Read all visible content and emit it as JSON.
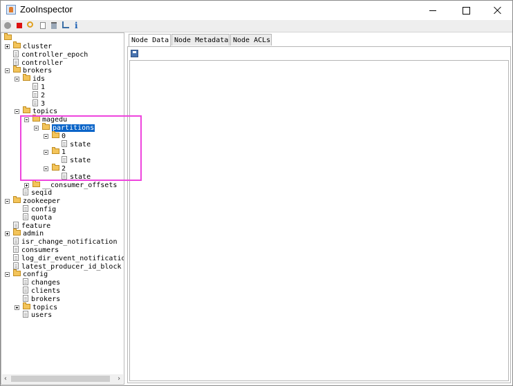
{
  "window": {
    "title": "ZooInspector",
    "controls": {
      "minimize": "minimize-icon",
      "maximize": "maximize-icon",
      "close": "close-icon"
    }
  },
  "toolbar": {
    "buttons": [
      "connect-icon",
      "disconnect-icon",
      "refresh-icon",
      "add-node-icon",
      "delete-node-icon",
      "add-watch-icon",
      "info-icon"
    ],
    "info_glyph": "i"
  },
  "tree": {
    "nodes": [
      {
        "label": "cluster",
        "type": "folder",
        "depth": 1,
        "expander": "plus"
      },
      {
        "label": "controller_epoch",
        "type": "file",
        "depth": 1
      },
      {
        "label": "controller",
        "type": "file",
        "depth": 1
      },
      {
        "label": "brokers",
        "type": "folder",
        "depth": 1,
        "expander": "minus"
      },
      {
        "label": "ids",
        "type": "folder",
        "depth": 2,
        "expander": "minus"
      },
      {
        "label": "1",
        "type": "file",
        "depth": 3
      },
      {
        "label": "2",
        "type": "file",
        "depth": 3
      },
      {
        "label": "3",
        "type": "file",
        "depth": 3
      },
      {
        "label": "topics",
        "type": "folder",
        "depth": 2,
        "expander": "minus"
      },
      {
        "label": "magedu",
        "type": "folder",
        "depth": 3,
        "expander": "minus"
      },
      {
        "label": "partitions",
        "type": "folder",
        "depth": 4,
        "expander": "minus",
        "selected": true
      },
      {
        "label": "0",
        "type": "folder",
        "depth": 5,
        "expander": "minus"
      },
      {
        "label": "state",
        "type": "file",
        "depth": 6
      },
      {
        "label": "1",
        "type": "folder",
        "depth": 5,
        "expander": "minus"
      },
      {
        "label": "state",
        "type": "file",
        "depth": 6
      },
      {
        "label": "2",
        "type": "folder",
        "depth": 5,
        "expander": "minus"
      },
      {
        "label": "state",
        "type": "file",
        "depth": 6
      },
      {
        "label": "__consumer_offsets",
        "type": "folder",
        "depth": 3,
        "expander": "plus"
      },
      {
        "label": "seqid",
        "type": "file",
        "depth": 2
      },
      {
        "label": "zookeeper",
        "type": "folder",
        "depth": 1,
        "expander": "minus"
      },
      {
        "label": "config",
        "type": "file",
        "depth": 2
      },
      {
        "label": "quota",
        "type": "file",
        "depth": 2
      },
      {
        "label": "feature",
        "type": "file",
        "depth": 1
      },
      {
        "label": "admin",
        "type": "folder",
        "depth": 1,
        "expander": "plus"
      },
      {
        "label": "isr_change_notification",
        "type": "file",
        "depth": 1
      },
      {
        "label": "consumers",
        "type": "file",
        "depth": 1
      },
      {
        "label": "log_dir_event_notification",
        "type": "file",
        "depth": 1
      },
      {
        "label": "latest_producer_id_block",
        "type": "file",
        "depth": 1
      },
      {
        "label": "config",
        "type": "folder",
        "depth": 1,
        "expander": "minus"
      },
      {
        "label": "changes",
        "type": "file",
        "depth": 2
      },
      {
        "label": "clients",
        "type": "file",
        "depth": 2
      },
      {
        "label": "brokers",
        "type": "file",
        "depth": 2
      },
      {
        "label": "topics",
        "type": "folder",
        "depth": 2,
        "expander": "plus"
      },
      {
        "label": "users",
        "type": "file",
        "depth": 2
      }
    ],
    "scroll_left": "‹",
    "scroll_right": "›"
  },
  "tabs": [
    {
      "label": "Node Data",
      "active": true
    },
    {
      "label": "Node Metadata",
      "active": false
    },
    {
      "label": "Node ACLs",
      "active": false
    }
  ],
  "content": {
    "save_icon": "save-icon",
    "node_data": ""
  }
}
